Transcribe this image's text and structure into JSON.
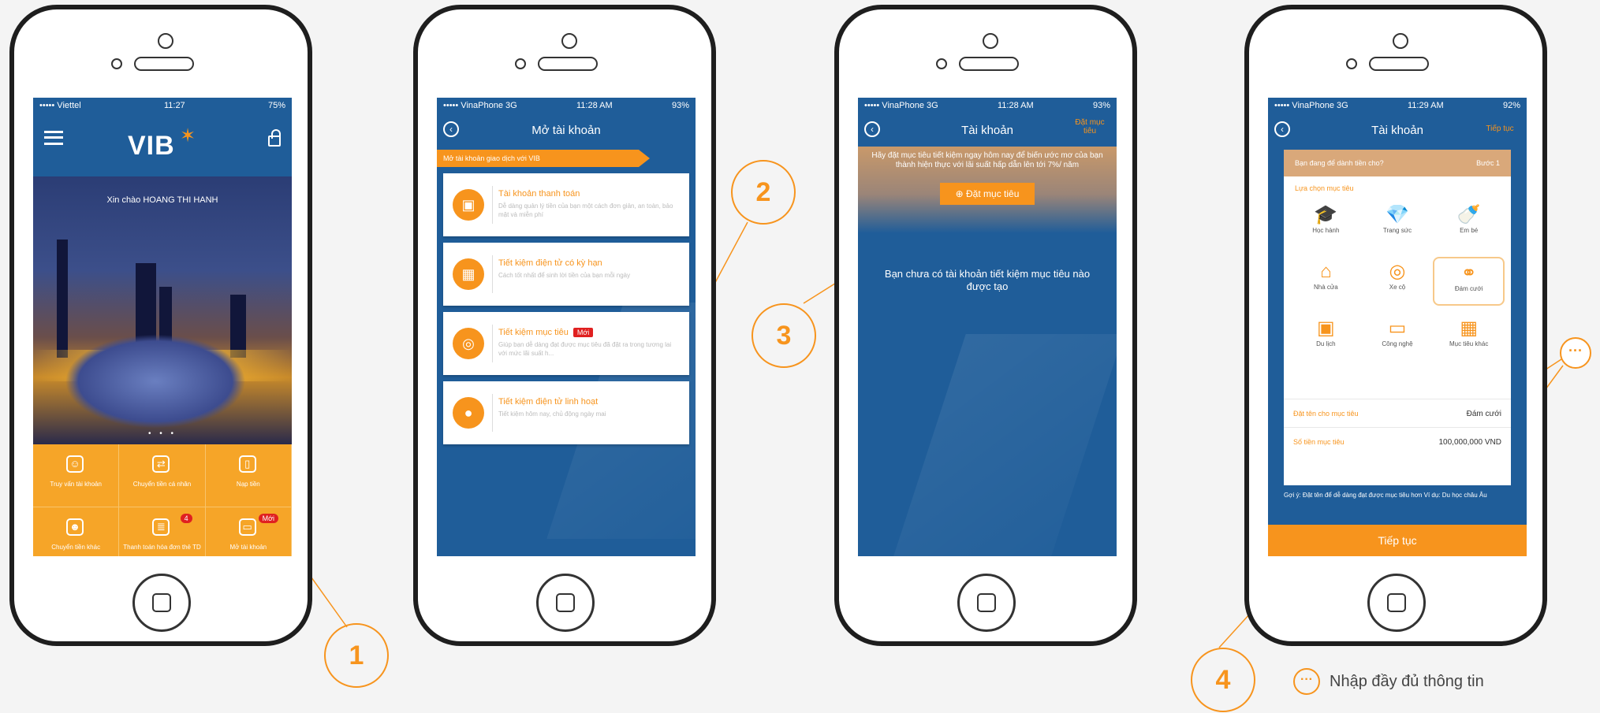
{
  "colors": {
    "brand_blue": "#1f5d99",
    "accent_orange": "#f7941d",
    "badge_red": "#e02020"
  },
  "phone1": {
    "status": {
      "carrier": "••••• Viettel",
      "time": "11:27",
      "battery": "75%"
    },
    "logo": "VIB",
    "greeting": "Xin chào HOANG THI HANH",
    "carousel_dots": "• • •",
    "tiles": [
      {
        "label": "Truy vấn tài khoản",
        "icon": "user-icon"
      },
      {
        "label": "Chuyển tiền cá nhân",
        "icon": "transfer-icon"
      },
      {
        "label": "Nạp tiền",
        "icon": "phone-topup-icon"
      },
      {
        "label": "Chuyển tiền khác",
        "icon": "transfer-other-icon"
      },
      {
        "label": "Thanh toán hóa đơn thẻ TD",
        "icon": "bill-icon",
        "badge": "4"
      },
      {
        "label": "Mở tài khoản",
        "icon": "folder-icon",
        "badge": "Mới"
      }
    ]
  },
  "phone2": {
    "status": {
      "carrier": "••••• VinaPhone  3G",
      "time": "11:28 AM",
      "battery": "93%"
    },
    "title": "Mở tài khoản",
    "banner": "Mở tài khoản giao dịch với VIB",
    "cards": [
      {
        "title": "Tài khoản thanh toán",
        "desc": "Dễ dàng quản lý tiền của bạn một cách đơn giản, an toàn, bảo mật và miễn phí"
      },
      {
        "title": "Tiết kiệm điện tử có kỳ hạn",
        "desc": "Cách tốt nhất để sinh lời tiền của bạn mỗi ngày"
      },
      {
        "title": "Tiết kiệm mục tiêu",
        "badge": "Mới",
        "desc": "Giúp bạn dễ dàng đạt được mục tiêu đã đặt ra trong tương lai với mức lãi suất h..."
      },
      {
        "title": "Tiết kiệm điện tử linh hoạt",
        "desc": "Tiết kiệm hôm nay, chủ động ngày mai"
      }
    ]
  },
  "phone3": {
    "status": {
      "carrier": "••••• VinaPhone  3G",
      "time": "11:28 AM",
      "battery": "93%"
    },
    "title": "Tài khoản",
    "right_action": "Đặt mục tiêu",
    "promo": "Hãy đặt mục tiêu tiết kiệm ngay hôm nay để biến ước mơ của bạn thành hiện thực với lãi suất hấp dẫn lên tới 7%/ năm",
    "cta": "⊕ Đặt mục tiêu",
    "empty": "Bạn chưa có tài khoản tiết kiệm mục tiêu nào được tạo"
  },
  "phone4": {
    "status": {
      "carrier": "••••• VinaPhone  3G",
      "time": "11:29 AM",
      "battery": "92%"
    },
    "title": "Tài khoản",
    "right_action": "Tiếp tục",
    "form_head": "Bạn đang để dành tiền cho?",
    "step": "Bước 1",
    "choose_label": "Lựa chọn mục tiêu",
    "goals": [
      {
        "label": "Học hành",
        "glyph": "🎓"
      },
      {
        "label": "Trang sức",
        "glyph": "💎"
      },
      {
        "label": "Em bé",
        "glyph": "🍼"
      },
      {
        "label": "Nhà cửa",
        "glyph": "⌂"
      },
      {
        "label": "Xe cộ",
        "glyph": "◎"
      },
      {
        "label": "Đám cưới",
        "glyph": "⚭",
        "selected": true
      },
      {
        "label": "Du lịch",
        "glyph": "▣"
      },
      {
        "label": "Công nghệ",
        "glyph": "▭"
      },
      {
        "label": "Mục tiêu khác",
        "glyph": "▦"
      }
    ],
    "name_label": "Đặt tên cho mục tiêu",
    "name_value": "Đám cưới",
    "amount_label": "Số tiền mục tiêu",
    "amount_value": "100,000,000  VND",
    "note": "Gợi ý: Đặt tên để dễ dàng đạt được mục tiêu hơn Ví dụ: Du học châu Âu",
    "cta": "Tiếp tục"
  },
  "annotations": [
    "1",
    "2",
    "3",
    "4"
  ],
  "legend": {
    "symbol": "···",
    "label": "Nhập đầy đủ thông tin"
  }
}
